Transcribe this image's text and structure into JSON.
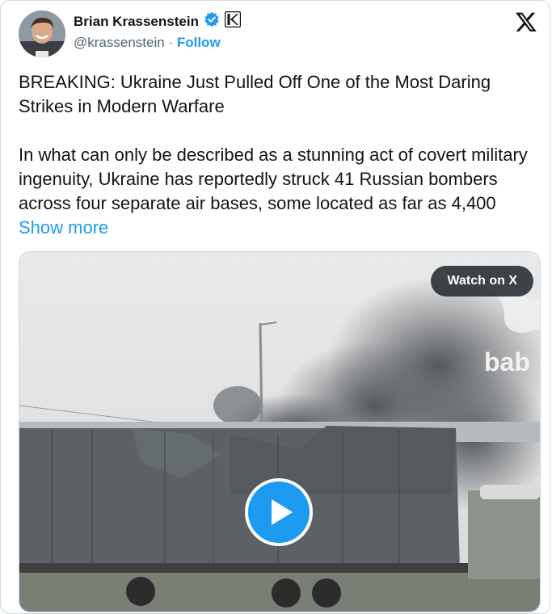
{
  "author": {
    "name": "Brian Krassenstein",
    "handle": "@krassenstein",
    "separator": "·",
    "follow_label": "Follow"
  },
  "tweet": {
    "text": "BREAKING: Ukraine Just Pulled Off One of the Most Daring Strikes in Modern Warfare\n\nIn what can only be described as a stunning act of covert military ingenuity, Ukraine has reportedly struck 41 Russian bombers across four separate air bases, some located as far as 4,400 ",
    "show_more_label": "Show more"
  },
  "media": {
    "watch_label": "Watch on X",
    "watermark_text": "bab"
  },
  "colors": {
    "accent": "#1d9bf0",
    "text": "#0f1419",
    "secondary": "#536471",
    "border": "#cfd9de",
    "verified": "#1d9bf0"
  },
  "icons": [
    "verified-badge-icon",
    "affiliate-badge-icon",
    "x-logo-icon",
    "play-icon"
  ]
}
